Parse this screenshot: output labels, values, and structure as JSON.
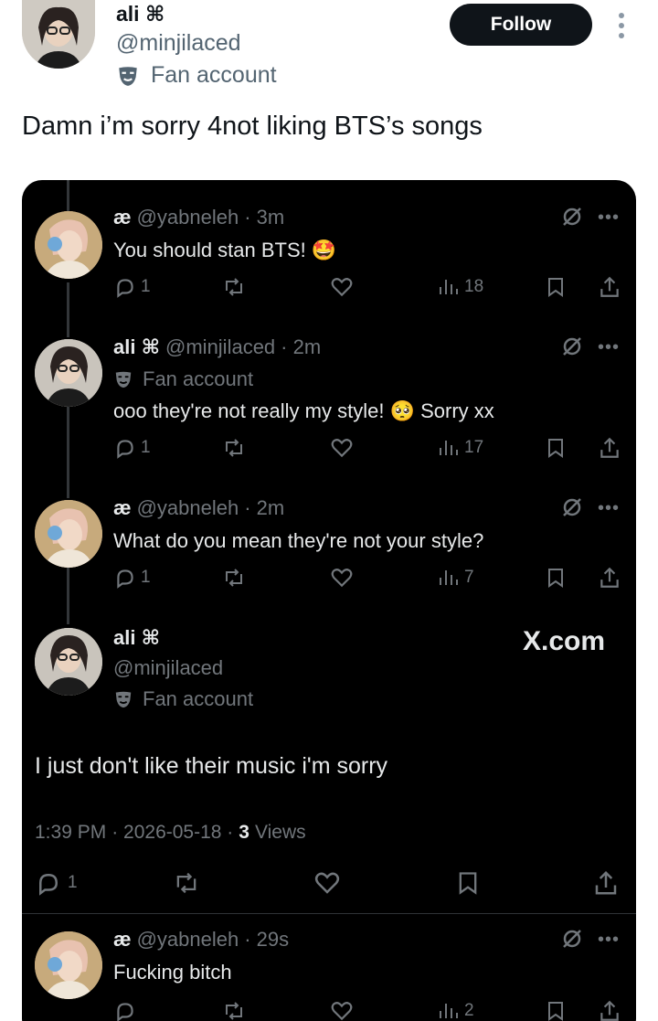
{
  "header": {
    "name": "ali",
    "name_glyph": "⌘",
    "handle": "@minjilaced",
    "badge": "Fan account",
    "follow_label": "Follow"
  },
  "post_text": "Damn i’m sorry 4not liking BTS’s songs",
  "embed": {
    "watermark": "X.com",
    "replies": [
      {
        "name": "æ",
        "handle": "@yabneleh",
        "time": "· 3m",
        "text": "You should stan BTS!",
        "emoji": "🤩",
        "replies": "1",
        "views": "18"
      },
      {
        "name": "ali",
        "name_glyph": "⌘",
        "handle": "@minjilaced",
        "time": "· 2m",
        "badge": "Fan account",
        "text": "ooo they're not really my style!",
        "emoji": "🥺",
        "text2": "Sorry xx",
        "replies": "1",
        "views": "17"
      },
      {
        "name": "æ",
        "handle": "@yabneleh",
        "time": "· 2m",
        "text": "What do you mean they're not your style?",
        "replies": "1",
        "views": "7"
      }
    ],
    "main": {
      "name": "ali",
      "name_glyph": "⌘",
      "handle": "@minjilaced",
      "badge": "Fan account",
      "text": "I just don't like their music   i'm sorry",
      "time": "1:39 PM",
      "date": "· 2026-05-18 ·",
      "views_count": "3",
      "views_label": "Views",
      "replies": "1"
    },
    "last_reply": {
      "name": "æ",
      "handle": "@yabneleh",
      "time": "· 29s",
      "text": "Fucking bitch",
      "views": "2"
    }
  },
  "colors": {
    "accent": "#0f1419",
    "dark_bg": "#000000",
    "muted": "#71767b"
  }
}
